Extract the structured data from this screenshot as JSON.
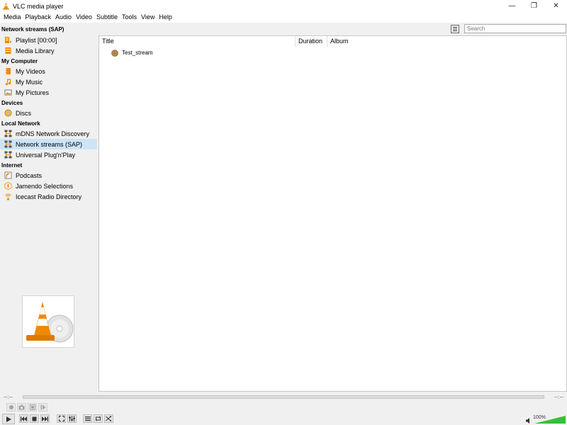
{
  "window": {
    "title": "VLC media player",
    "controls": {
      "minimize": "—",
      "maximize": "❐",
      "close": "✕"
    }
  },
  "menubar": [
    "Media",
    "Playback",
    "Audio",
    "Video",
    "Subtitle",
    "Tools",
    "View",
    "Help"
  ],
  "sidebar": {
    "heading": "Network streams (SAP)",
    "top_items": [
      {
        "label": "Playlist [00:00]",
        "icon": "playlist-icon"
      },
      {
        "label": "Media Library",
        "icon": "media-library-icon"
      }
    ],
    "sections": [
      {
        "title": "My Computer",
        "items": [
          {
            "label": "My Videos",
            "icon": "videos-icon"
          },
          {
            "label": "My Music",
            "icon": "music-icon"
          },
          {
            "label": "My Pictures",
            "icon": "pictures-icon"
          }
        ]
      },
      {
        "title": "Devices",
        "items": [
          {
            "label": "Discs",
            "icon": "disc-icon"
          }
        ]
      },
      {
        "title": "Local Network",
        "items": [
          {
            "label": "mDNS Network Discovery",
            "icon": "network-icon"
          },
          {
            "label": "Network streams (SAP)",
            "icon": "network-icon",
            "selected": true
          },
          {
            "label": "Universal Plug'n'Play",
            "icon": "network-icon"
          }
        ]
      },
      {
        "title": "Internet",
        "items": [
          {
            "label": "Podcasts",
            "icon": "podcast-icon"
          },
          {
            "label": "Jamendo Selections",
            "icon": "jamendo-icon"
          },
          {
            "label": "Icecast Radio Directory",
            "icon": "icecast-icon"
          }
        ]
      }
    ]
  },
  "search": {
    "placeholder": "Search"
  },
  "playlist": {
    "columns": [
      "Title",
      "Duration",
      "Album"
    ],
    "rows": [
      {
        "title": "Test_stream",
        "duration": "",
        "album": ""
      }
    ]
  },
  "player": {
    "time_elapsed": "--:--",
    "time_total": "--:--",
    "volume": "100%",
    "volume_level": 1.0
  },
  "colors": {
    "accent_orange": "#f08a00",
    "selection": "#cce4f7",
    "volume_green": "#35c135"
  }
}
